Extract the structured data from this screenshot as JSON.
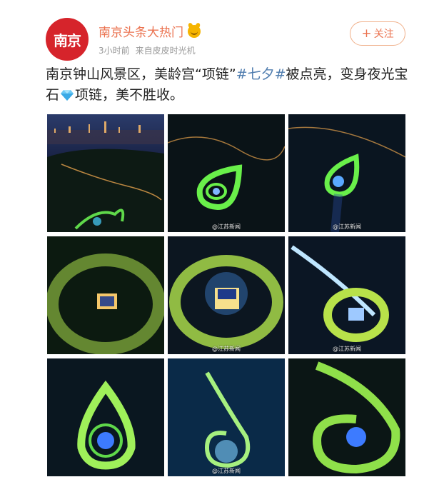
{
  "header": {
    "avatar_text": "南京",
    "account_name": "南京头条大热门",
    "badge_icon": "golden-crown-badge-icon",
    "time": "3小时前",
    "source": "来自皮皮时光机",
    "follow_label": "关注"
  },
  "post": {
    "text_part1": "南京钟山风景区，美龄宫“项链”",
    "hashtag": "#七夕#",
    "text_part2": "被点亮，变身夜光宝石",
    "gem_icon": "diamond-emoji",
    "text_part3": "项链，美不胜收。"
  },
  "images": {
    "watermark": "@江苏新闻",
    "count": 9
  },
  "colors": {
    "name": "#eb7350",
    "hashtag": "#507daf",
    "avatar": "#d6242b"
  }
}
